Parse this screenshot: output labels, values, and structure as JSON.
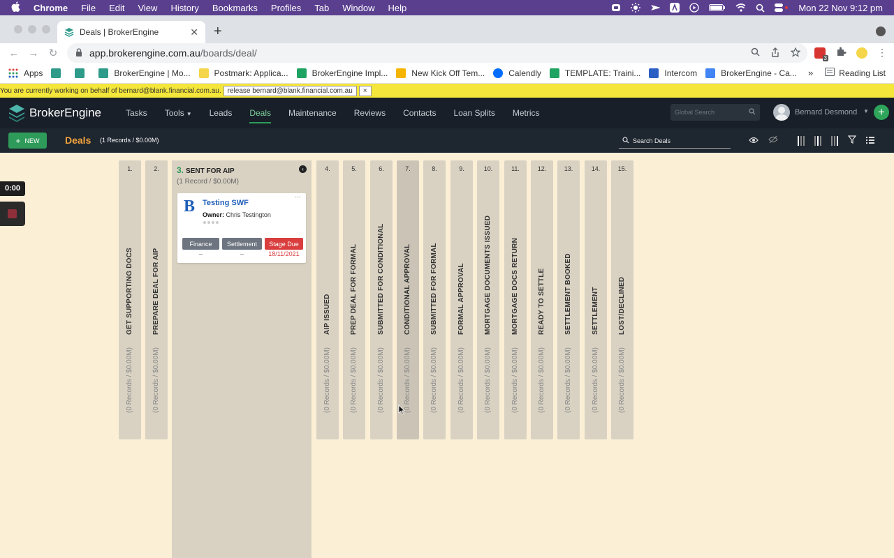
{
  "mac_menu": {
    "app": "Chrome",
    "items": [
      "File",
      "Edit",
      "View",
      "History",
      "Bookmarks",
      "Profiles",
      "Tab",
      "Window",
      "Help"
    ],
    "datetime": "Mon 22 Nov  9:12 pm"
  },
  "browser": {
    "tab_title": "Deals | BrokerEngine",
    "url_host": "app.brokerengine.com.au",
    "url_path": "/boards/deal/",
    "ext_badge": "3",
    "bookmarks": [
      "Apps",
      "",
      "",
      "BrokerEngine | Mo...",
      "Postmark: Applica...",
      "BrokerEngine Impl...",
      "New Kick Off Tem...",
      "Calendly",
      "TEMPLATE: Traini...",
      "Intercom",
      "BrokerEngine - Ca..."
    ],
    "more_bookmarks": "»",
    "reading_list": "Reading List"
  },
  "impersonation": {
    "message": "You are currently working on behalf of bernard@blank.financial.com.au.",
    "release_label": "release bernard@blank.financial.com.au",
    "close_label": "×"
  },
  "header": {
    "logo_text": "BrokerEngine",
    "nav": [
      "Tasks",
      "Tools",
      "Leads",
      "Deals",
      "Maintenance",
      "Reviews",
      "Contacts",
      "Loan Splits",
      "Metrics"
    ],
    "active_nav": "Deals",
    "global_search_placeholder": "Global Search",
    "user_name": "Bernard Desmond"
  },
  "subbar": {
    "new_label": "NEW",
    "title": "Deals",
    "count": "(1 Records / $0.00M)",
    "search_placeholder": "Search Deals"
  },
  "recorder": {
    "time": "0:00"
  },
  "board": {
    "columns": [
      {
        "num": "1.",
        "title": "GET SUPPORTING DOCS",
        "summary": "(0 Records / $0.00M)"
      },
      {
        "num": "2.",
        "title": "PREPARE DEAL FOR AIP",
        "summary": "(0 Records / $0.00M)"
      },
      {
        "num": "3.",
        "title": "SENT FOR AIP",
        "summary": "(1 Record / $0.00M)"
      },
      {
        "num": "4.",
        "title": "AIP ISSUED",
        "summary": "(0 Records / $0.00M)"
      },
      {
        "num": "5.",
        "title": "PREP DEAL FOR FORMAL",
        "summary": "(0 Records / $0.00M)"
      },
      {
        "num": "6.",
        "title": "SUBMITTED FOR CONDITIONAL",
        "summary": "(0 Records / $0.00M)"
      },
      {
        "num": "7.",
        "title": "CONDITIONAL APPROVAL",
        "summary": "(0 Records / $0.00M)"
      },
      {
        "num": "8.",
        "title": "SUBMITTED FOR FORMAL",
        "summary": "(0 Records / $0.00M)"
      },
      {
        "num": "9.",
        "title": "FORMAL APPROVAL",
        "summary": "(0 Records / $0.00M)"
      },
      {
        "num": "10.",
        "title": "MORTGAGE DOCUMENTS ISSUED",
        "summary": "(0 Records / $0.00M)"
      },
      {
        "num": "11.",
        "title": "MORTGAGE DOCS RETURN",
        "summary": "(0 Records / $0.00M)"
      },
      {
        "num": "12.",
        "title": "READY TO SETTLE",
        "summary": "(0 Records / $0.00M)"
      },
      {
        "num": "13.",
        "title": "SETTLEMENT BOOKED",
        "summary": "(0 Records / $0.00M)"
      },
      {
        "num": "14.",
        "title": "SETTLEMENT",
        "summary": "(0 Records / $0.00M)"
      },
      {
        "num": "15.",
        "title": "LOST/DECLINED",
        "summary": "(0 Records / $0.00M)"
      }
    ],
    "open_num": "3.",
    "card": {
      "title": "Testing SWF",
      "owner_label": "Owner:",
      "owner_name": "Chris Testington",
      "tags": [
        {
          "label": "Finance",
          "value": "–"
        },
        {
          "label": "Settlement",
          "value": "–"
        },
        {
          "label": "Stage Due",
          "value": "18/11/2021"
        }
      ]
    }
  },
  "colors": {
    "board_bg": "#fbefd6",
    "header_bg": "#181f28",
    "accent_green": "#2e9b5a",
    "deals_orange": "#f2a33c",
    "stage_due_red": "#d93d3d",
    "card_title_blue": "#1f5fb8"
  }
}
